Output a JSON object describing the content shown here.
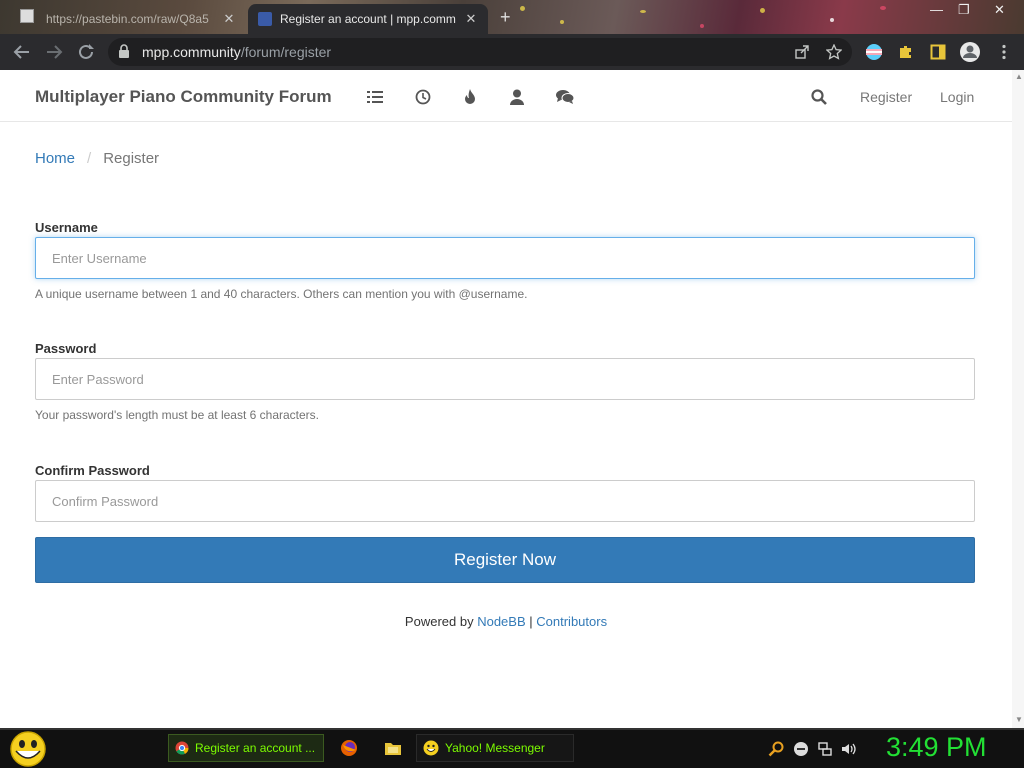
{
  "browser": {
    "tabs": [
      {
        "title": "https://pastebin.com/raw/Q8a5"
      },
      {
        "title": "Register an account | mpp.comm"
      }
    ],
    "url_host": "mpp.community",
    "url_path": "/forum/register"
  },
  "forum": {
    "brand": "Multiplayer Piano Community Forum",
    "nav_icons": [
      "list-icon",
      "clock-icon",
      "fire-icon",
      "user-icon",
      "comments-icon"
    ],
    "register_link": "Register",
    "login_link": "Login"
  },
  "breadcrumb": {
    "home": "Home",
    "separator": "/",
    "current": "Register"
  },
  "form": {
    "username": {
      "label": "Username",
      "placeholder": "Enter Username",
      "value": "",
      "help": "A unique username between 1 and 40 characters. Others can mention you with @username."
    },
    "password": {
      "label": "Password",
      "placeholder": "Enter Password",
      "value": "",
      "help": "Your password's length must be at least 6 characters."
    },
    "confirm": {
      "label": "Confirm Password",
      "placeholder": "Confirm Password",
      "value": ""
    },
    "submit_label": "Register Now"
  },
  "footer": {
    "powered_by": "Powered by",
    "nodebb": "NodeBB",
    "sep": "|",
    "contributors": "Contributors"
  },
  "taskbar": {
    "task1": "Register an account ...",
    "task2": "Yahoo! Messenger",
    "clock": "3:49 PM"
  },
  "colors": {
    "primary": "#337ab7",
    "clock": "#22e034",
    "taskbar_text": "#7CFC00"
  }
}
